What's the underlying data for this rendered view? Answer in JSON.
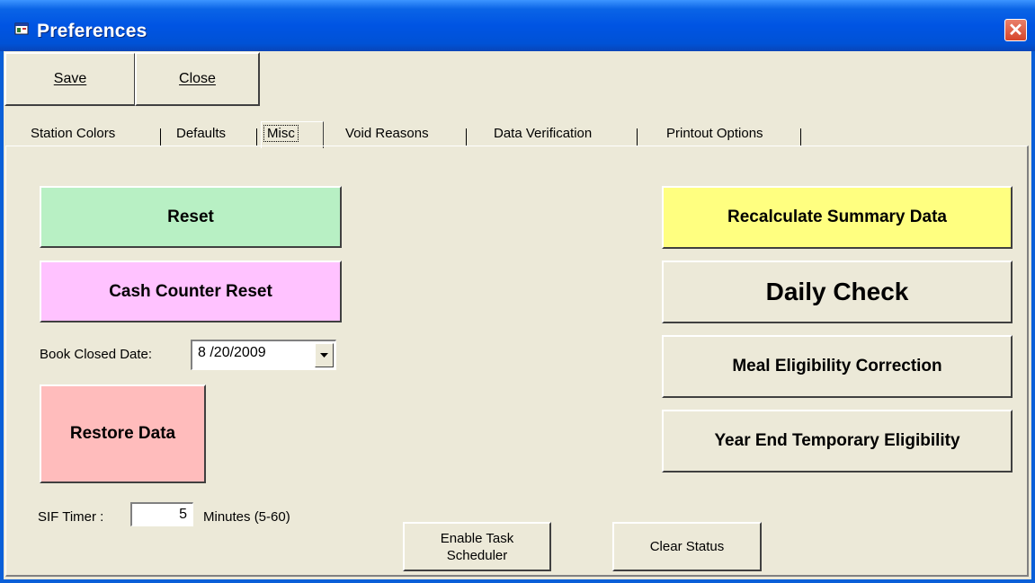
{
  "window": {
    "title": "Preferences",
    "close_glyph": "✕"
  },
  "toolbar": {
    "save_label": "Save",
    "close_label": "Close"
  },
  "tabs": [
    "Station Colors",
    "Defaults",
    "Misc",
    "Void Reasons",
    "Data Verification",
    "Printout Options"
  ],
  "active_tab": "Misc",
  "misc": {
    "reset_label": "Reset",
    "cash_counter_reset_label": "Cash Counter Reset",
    "book_closed_label": "Book Closed Date:",
    "book_closed_value": "8 /20/2009",
    "restore_label": "Restore Data",
    "sif_label": "SIF Timer :",
    "sif_value": "5",
    "sif_unit": "Minutes  (5-60)",
    "enable_task_line1": "Enable Task",
    "enable_task_line2": "Scheduler",
    "clear_status_label": "Clear Status",
    "recalc_label": "Recalculate Summary Data",
    "daily_check_label": "Daily Check",
    "meal_label": "Meal Eligibility Correction",
    "year_end_label": "Year End Temporary Eligibility"
  },
  "colors": {
    "reset": "#b8f0c4",
    "cash_counter_reset": "#ffc2ff",
    "restore": "#ffbcbc",
    "recalc": "#ffff80",
    "face": "#ece9d8"
  },
  "icons": {
    "title": "application-window-icon",
    "dropdown": "chevron-down-icon"
  }
}
